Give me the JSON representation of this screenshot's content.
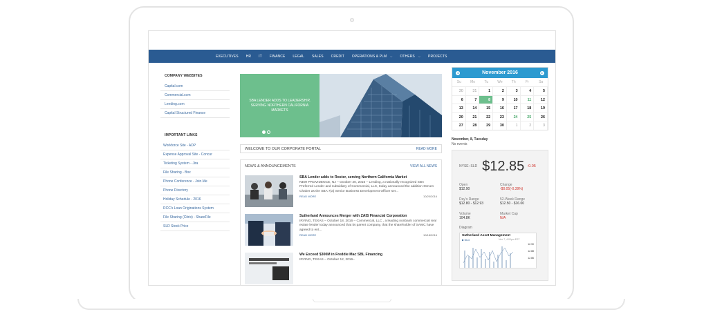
{
  "nav": {
    "items": [
      {
        "label": "EXECUTIVES",
        "caret": false
      },
      {
        "label": "HR",
        "caret": false
      },
      {
        "label": "IT",
        "caret": false
      },
      {
        "label": "FINANCE",
        "caret": false
      },
      {
        "label": "LEGAL",
        "caret": false
      },
      {
        "label": "SALES",
        "caret": false
      },
      {
        "label": "CREDIT",
        "caret": false
      },
      {
        "label": "OPERATIONS & PLM",
        "caret": true
      },
      {
        "label": "OTHERS",
        "caret": true
      },
      {
        "label": "PROJECTS",
        "caret": false
      }
    ],
    "caret_symbol": "⌵"
  },
  "sidebar": {
    "company_title": "COMPANY WEBSITES",
    "company_links": [
      "Capital.com",
      "Commercial.com",
      "Lending.com",
      "Capital Structured Finance"
    ],
    "important_title": "IMPORTANT LINKS",
    "important_links": [
      "Workforce Site - ADP",
      "Expense Approval Site - Concur",
      "Ticketing System - Jira",
      "File Sharing - Box",
      "Phone Conference - Join.Me",
      "Phone Directory",
      "Holiday Schedule - 2016",
      "RCC's Loan Originations System",
      "File Sharing (Citrix) - ShareFile",
      "SLD Stock Price"
    ]
  },
  "hero": {
    "text": "SBA LENDER ADDS TO LEADERSHIP, SERVING NORTHERN CALIFORNIA MARKETS",
    "slides": 2,
    "active_slide": 1
  },
  "welcome": {
    "text": "WELCOME TO OUR CORPORATE PORTAL",
    "link": "READ MORE"
  },
  "news": {
    "title": "NEWS & ANNOUNCEMENTS",
    "view_all": "VIEW ALL NEWS",
    "items": [
      {
        "headline": "SBA Lender adds to Roster, serving Northern California Market",
        "body": "NEW PROVIDENCE, NJ – October 20, 2016 –  Lending, a nationally recognized SBA Preferred Lender and subsidiary of  Commercial, LLC, today announced the addition Steven Chaker as the SBA 7(a) Senior Business Development Officer ser...",
        "more": "READ MORE",
        "date": "10/20/2016"
      },
      {
        "headline": "Sutherland Announces Merger with ZAIS Financial Corporation",
        "body": "IRVING, TEXAS – October 18, 2016 –  Commercial, LLC , a leading nonbank commercial real estate lender today announced that its parent company,                          that the shareholder of SAMC have agreed to ent...",
        "more": "READ MORE",
        "date": "10/18/2016"
      },
      {
        "headline": "We Exceed $300M in Freddie Mac SBL Financing",
        "body": "IRVING, TEXAS – October 12, 2016–",
        "more": "",
        "date": ""
      }
    ]
  },
  "calendar": {
    "month": "November  2016",
    "prev": "◂",
    "next": "▸",
    "dow": [
      "Su",
      "Mo",
      "Tu",
      "We",
      "Th",
      "Fr",
      "Sa"
    ],
    "weeks": [
      [
        {
          "d": "30",
          "m": true
        },
        {
          "d": "31",
          "m": true
        },
        {
          "d": "1"
        },
        {
          "d": "2"
        },
        {
          "d": "3"
        },
        {
          "d": "4"
        },
        {
          "d": "5"
        }
      ],
      [
        {
          "d": "6"
        },
        {
          "d": "7"
        },
        {
          "d": "8",
          "today": true
        },
        {
          "d": "9"
        },
        {
          "d": "10"
        },
        {
          "d": "11",
          "g": true
        },
        {
          "d": "12"
        }
      ],
      [
        {
          "d": "13"
        },
        {
          "d": "14"
        },
        {
          "d": "15"
        },
        {
          "d": "16"
        },
        {
          "d": "17"
        },
        {
          "d": "18"
        },
        {
          "d": "19"
        }
      ],
      [
        {
          "d": "20"
        },
        {
          "d": "21"
        },
        {
          "d": "22"
        },
        {
          "d": "23"
        },
        {
          "d": "24",
          "g": true
        },
        {
          "d": "25",
          "g": true
        },
        {
          "d": "26"
        }
      ],
      [
        {
          "d": "27"
        },
        {
          "d": "28"
        },
        {
          "d": "29"
        },
        {
          "d": "30"
        },
        {
          "d": "1",
          "m": true
        },
        {
          "d": "2",
          "m": true
        },
        {
          "d": "3",
          "m": true
        }
      ]
    ]
  },
  "events": {
    "date": "November, 8, Tuesday",
    "text": "No events"
  },
  "stock": {
    "symbol": "NYSE: SLD",
    "price": "$12.85",
    "change": "-0.05",
    "fields": [
      {
        "label": "Open",
        "value": "$12.90",
        "red": false
      },
      {
        "label": "Change",
        "value": "-$0.05(-0.39%)",
        "red": true
      },
      {
        "label": "Day's Range",
        "value": "$12.80 - $12.93",
        "red": false
      },
      {
        "label": "52-Week Range",
        "value": "$12.50 - $16.00",
        "red": false
      },
      {
        "label": "Volume",
        "value": "104.8K",
        "red": false
      },
      {
        "label": "Market Cap",
        "value": "N/A",
        "red": true
      }
    ],
    "diagram_label": "Diagram",
    "chart": {
      "title": "Sutherland Asset Management",
      "legend": "SLD",
      "note": "Nov 7, 4:00pm EST",
      "ticks": [
        "12.90",
        "12.88",
        "12.86"
      ]
    }
  },
  "colors": {
    "nav_bg": "#2a5b92",
    "accent_green": "#6dbf8d",
    "calendar_blue": "#2c9ad0",
    "link_blue": "#3a6aa0",
    "negative_red": "#d0342c"
  }
}
